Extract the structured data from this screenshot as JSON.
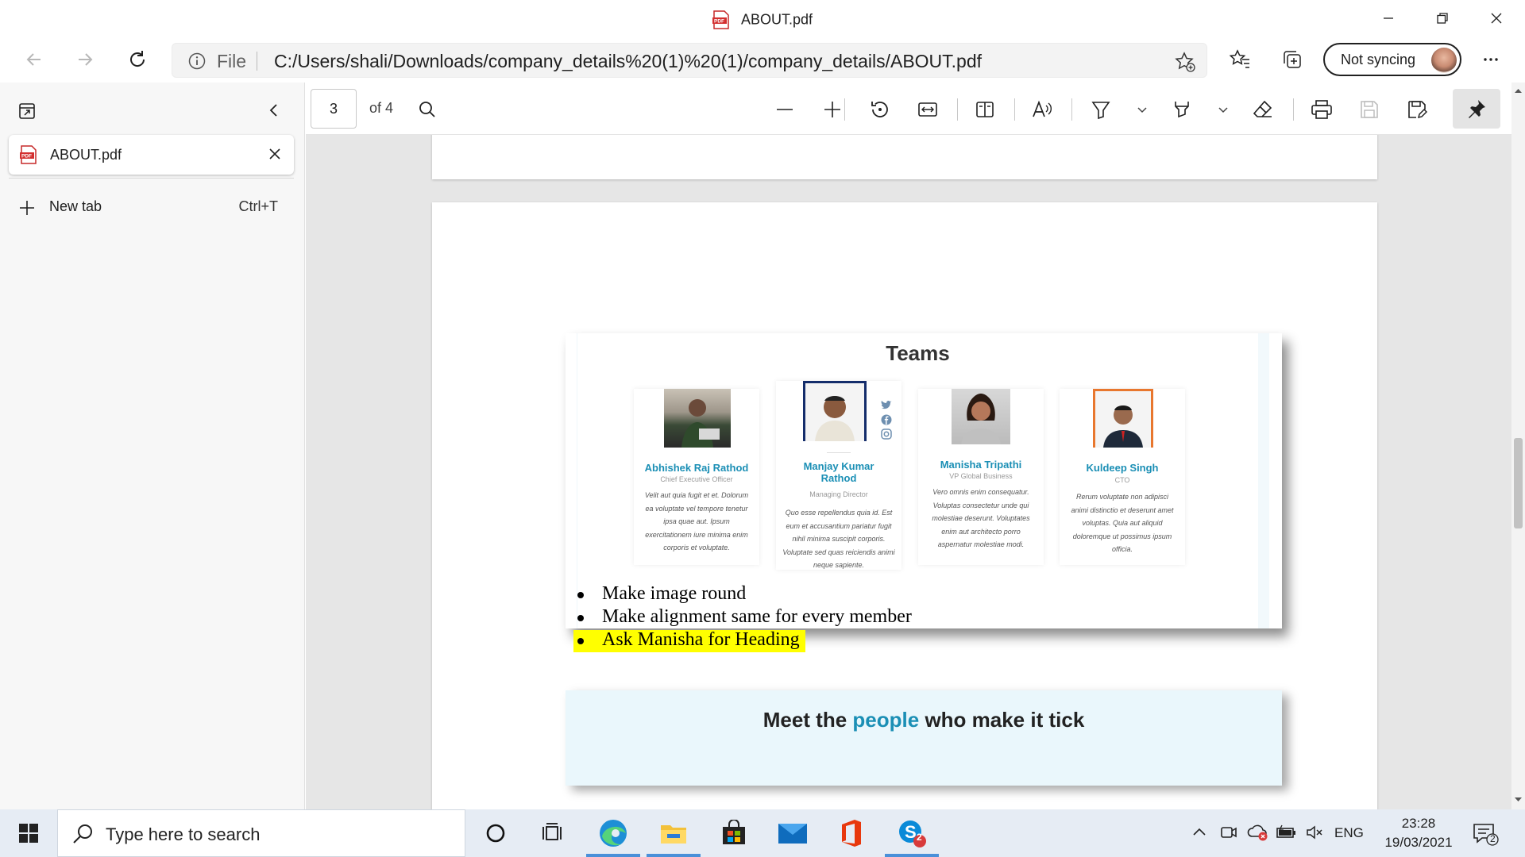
{
  "window": {
    "title": "ABOUT.pdf",
    "controls": [
      "minimize-icon",
      "restore-icon",
      "close-icon"
    ]
  },
  "navbar": {
    "scheme": "File",
    "url": "C:/Users/shali/Downloads/company_details%20(1)%20(1)/company_details/ABOUT.pdf",
    "profile_label": "Not syncing"
  },
  "sidebar": {
    "tabs": [
      {
        "label": "ABOUT.pdf",
        "icon": "pdf-file-icon"
      }
    ],
    "new_tab_label": "New tab",
    "new_tab_shortcut": "Ctrl+T"
  },
  "pdf_toolbar": {
    "current_page": "3",
    "page_total": "of 4"
  },
  "document": {
    "teams_image": {
      "heading": "Teams",
      "members": [
        {
          "name": "Abhishek Raj Rathod",
          "role": "Chief Executive Officer",
          "desc": "Velit aut quia fugit et et. Dolorum ea voluptate vel tempore tenetur ipsa quae aut. Ipsum exercitationem iure minima enim corporis et voluptate."
        },
        {
          "name": "Manjay Kumar Rathod",
          "role": "Managing Director",
          "desc": "Quo esse repellendus quia id. Est eum et accusantium pariatur fugit nihil minima suscipit corporis. Voluptate sed quas reiciendis animi neque sapiente."
        },
        {
          "name": "Manisha Tripathi",
          "role": "VP Global Business",
          "desc": "Vero omnis enim consequatur. Voluptas consectetur unde qui molestiae deserunt. Voluptates enim aut architecto porro aspernatur molestiae modi."
        },
        {
          "name": "Kuldeep Singh",
          "role": "CTO",
          "desc": "Rerum voluptate non adipisci animi distinctio et deserunt amet voluptas. Quia aut aliquid doloremque ut possimus ipsum officia."
        }
      ]
    },
    "bullets": [
      {
        "text": "Make image round",
        "highlight": false
      },
      {
        "text": "Make alignment same for every member",
        "highlight": false
      },
      {
        "text": "Ask Manisha for Heading",
        "highlight": true,
        "highlight_color": "#ffff00"
      }
    ],
    "meet_image": {
      "title_before": "Meet the",
      "title_accent": "people",
      "title_after": "who make it tick",
      "accent_color": "#1b8fb5"
    }
  },
  "taskbar": {
    "search_placeholder": "Type here to search",
    "apps": [
      "cortana-icon",
      "task-view-icon",
      "edge-icon",
      "file-explorer-icon",
      "store-icon",
      "mail-icon",
      "office-icon",
      "skype-icon"
    ],
    "skype_badge": "2",
    "language": "ENG",
    "time": "23:28",
    "date": "19/03/2021",
    "notification_count": "2"
  }
}
